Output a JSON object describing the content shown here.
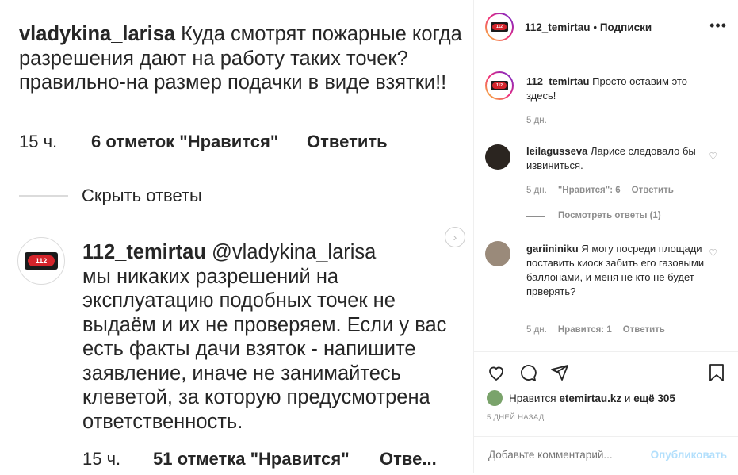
{
  "post_image": {
    "comment1": {
      "user": "vladykina_larisa",
      "text": "Куда смотрят пожарные когда разрешения дают на работу таких точек? правильно-на размер подачки в виде взятки!!",
      "time": "15 ч.",
      "likes": "6 отметок \"Нравится\"",
      "reply": "Ответить"
    },
    "hide_replies": "Скрыть ответы",
    "comment2": {
      "user": "112_temirtau",
      "mention": "@vladykina_larisa",
      "text": "мы никаких разрешений на эксплуатацию подобных точек не выдаём и их не проверяем. Если у вас есть факты дачи взяток - напишите заявление, иначе не занимайтесь клеветой, за которую предусмотрена ответственность.",
      "time": "15 ч.",
      "likes": "51 отметка \"Нравится\"",
      "reply": "Отве..."
    },
    "logo_text": "112"
  },
  "header": {
    "username": "112_temirtau",
    "separator": "•",
    "follow": "Подписки",
    "more": "•••"
  },
  "comments": [
    {
      "user": "112_temirtau",
      "text": "Просто оставим это здесь!",
      "time": "5 дн."
    },
    {
      "user": "leilagusseva",
      "text": "Ларисе следовало бы извиниться.",
      "time": "5 дн.",
      "likes": "\"Нравится\": 6",
      "reply": "Ответить"
    },
    {
      "user": "gariininiku",
      "text": "Я могу посреди площади поставить киоск забить его газовыми баллонами, и меня не кто не будет прверять?",
      "time": "5 дн.",
      "likes": "Нравится: 1",
      "reply": "Ответить"
    }
  ],
  "view_replies": "Посмотреть ответы (1)",
  "likes_line": {
    "prefix": "Нравится",
    "user": "etemirtau.kz",
    "middle": "и",
    "rest": "ещё 305"
  },
  "date": "5 ДНЕЙ НАЗАД",
  "add_comment": {
    "placeholder": "Добавьте комментарий...",
    "publish": "Опубликовать"
  },
  "colors": {
    "accent": "#0095f6",
    "publish_disabled": "#b2dffc",
    "muted": "#8e8e8e",
    "brand_red": "#d4242b"
  }
}
